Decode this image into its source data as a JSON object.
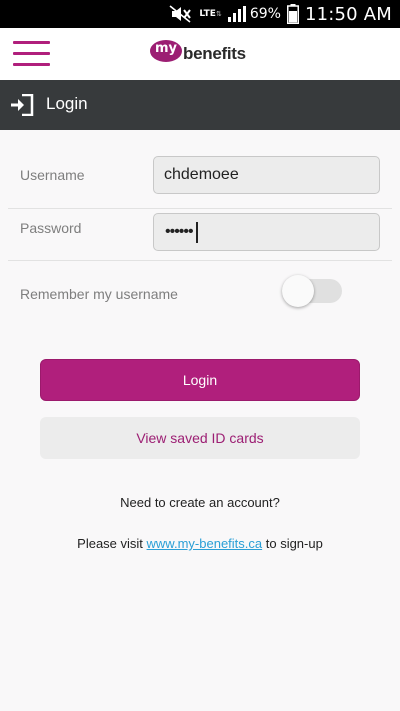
{
  "status_bar": {
    "lte": "LTE",
    "battery_percent": "69%",
    "time": "11:50 AM"
  },
  "header": {
    "menu_icon": "hamburger-icon",
    "logo_my": "my",
    "logo_word": "benefits"
  },
  "title_bar": {
    "icon": "sign-in-icon",
    "title": "Login"
  },
  "form": {
    "username_label": "Username",
    "username_value": "chdemoee",
    "password_label": "Password",
    "password_masked": "••••••",
    "remember_label": "Remember my username",
    "remember_enabled": false
  },
  "buttons": {
    "login": "Login",
    "view_cards": "View saved ID cards"
  },
  "footer": {
    "create_account": "Need to create an account?",
    "visit_prefix": "Please visit ",
    "visit_link": "www.my-benefits.ca",
    "visit_suffix": " to sign-up"
  },
  "colors": {
    "brand": "#b01f7c",
    "title_bar": "#373a3c",
    "link": "#2a9fd6"
  }
}
